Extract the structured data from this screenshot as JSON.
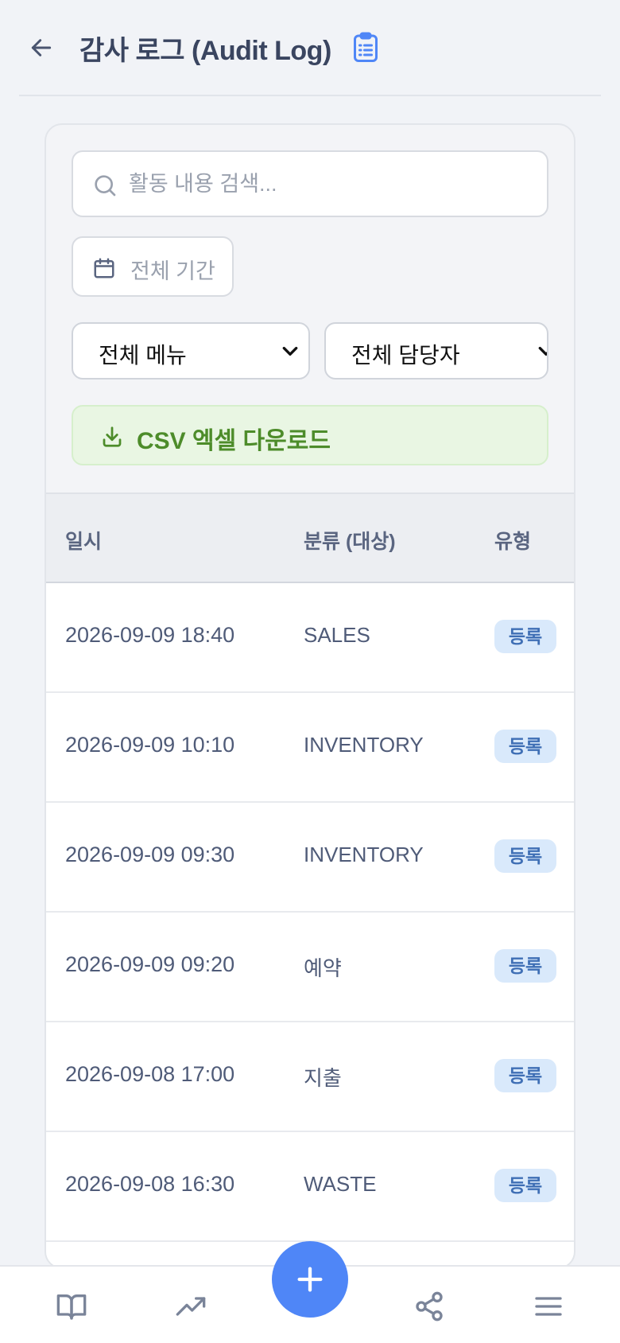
{
  "header": {
    "title": "감사 로그 (Audit Log)",
    "icon": "clipboard-icon",
    "accent": "#4f86f7"
  },
  "filters": {
    "search_placeholder": "활동 내용 검색...",
    "date_label": "전체 기간",
    "menu_select": "전체 메뉴",
    "staff_select": "전체 담당자",
    "csv_label": "CSV 엑셀 다운로드"
  },
  "table": {
    "columns": [
      "일시",
      "분류 (대상)",
      "유형"
    ],
    "rows": [
      {
        "date": "2026-09-09 18:40",
        "category": "SALES",
        "type": "등록"
      },
      {
        "date": "2026-09-09 10:10",
        "category": "INVENTORY",
        "type": "등록"
      },
      {
        "date": "2026-09-09 09:30",
        "category": "INVENTORY",
        "type": "등록"
      },
      {
        "date": "2026-09-09 09:20",
        "category": "예약",
        "type": "등록"
      },
      {
        "date": "2026-09-08 17:00",
        "category": "지출",
        "type": "등록"
      },
      {
        "date": "2026-09-08 16:30",
        "category": "WASTE",
        "type": "등록"
      }
    ]
  },
  "bottom_nav": {
    "items": [
      "book-icon",
      "trending-up-icon",
      "plus-icon",
      "share-icon",
      "menu-icon"
    ]
  }
}
